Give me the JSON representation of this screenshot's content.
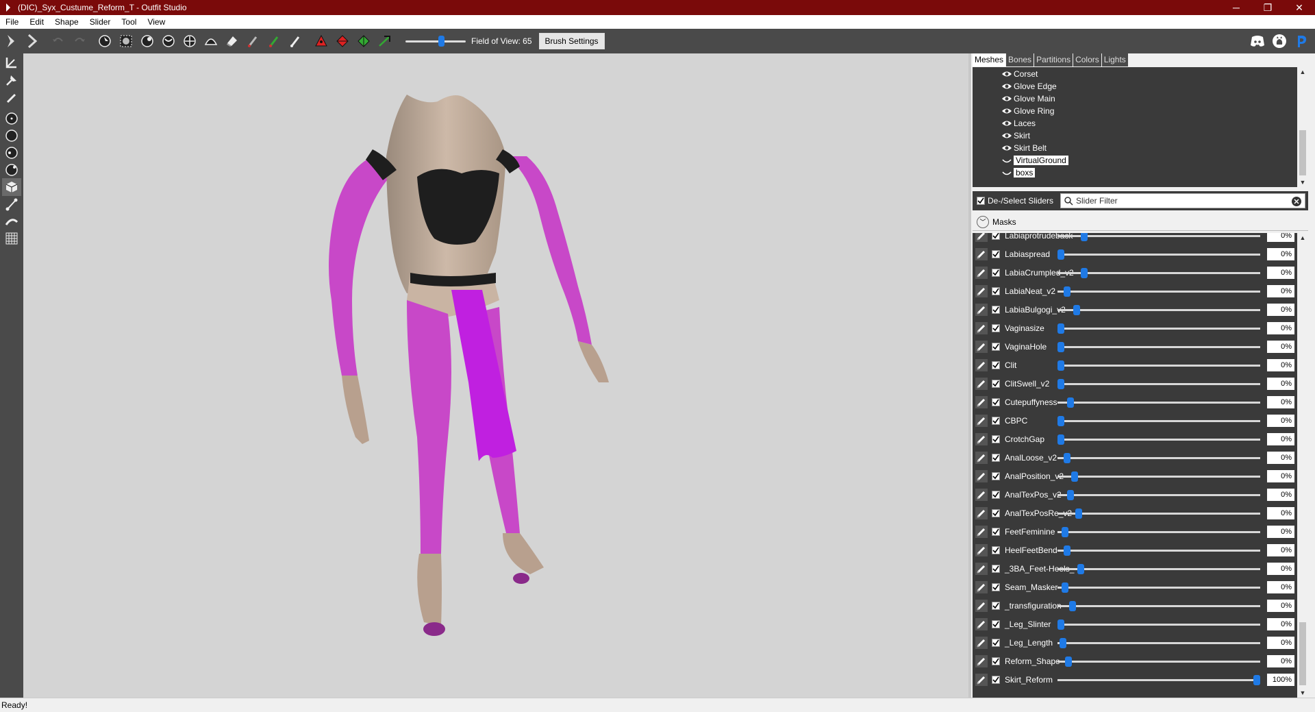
{
  "window": {
    "title": "(DIC)_Syx_Custume_Reform_T - Outfit Studio",
    "minimize": "─",
    "restore": "❐",
    "close": "✕"
  },
  "menu": [
    "File",
    "Edit",
    "Shape",
    "Slider",
    "Tool",
    "View"
  ],
  "toolbar": {
    "fov_label": "Field of View: 65",
    "fov_value": 65,
    "brush_settings_label": "Brush Settings"
  },
  "tabs": [
    {
      "label": "Meshes",
      "active": true
    },
    {
      "label": "Bones",
      "active": false
    },
    {
      "label": "Partitions",
      "active": false
    },
    {
      "label": "Colors",
      "active": false
    },
    {
      "label": "Lights",
      "active": false
    }
  ],
  "meshes": [
    {
      "name": "Corset",
      "visible": true
    },
    {
      "name": "Glove Edge",
      "visible": true
    },
    {
      "name": "Glove Main",
      "visible": true
    },
    {
      "name": "Glove Ring",
      "visible": true
    },
    {
      "name": "Laces",
      "visible": true
    },
    {
      "name": "Skirt",
      "visible": true
    },
    {
      "name": "Skirt Belt",
      "visible": true
    },
    {
      "name": "VirtualGround",
      "visible": false
    },
    {
      "name": "boxs",
      "visible": false
    }
  ],
  "sliders_header": {
    "deselect_label": "De-/Select Sliders",
    "filter_placeholder": "Slider Filter",
    "masks_label": "Masks"
  },
  "sliders": [
    {
      "name": "Labiaprotrudeback",
      "value": "0%",
      "pos": 0.12
    },
    {
      "name": "Labiaspread",
      "value": "0%",
      "pos": 0.0
    },
    {
      "name": "LabiaCrumpled_v2",
      "value": "0%",
      "pos": 0.12
    },
    {
      "name": "LabiaNeat_v2",
      "value": "0%",
      "pos": 0.03
    },
    {
      "name": "LabiaBulgogi_v2",
      "value": "0%",
      "pos": 0.08
    },
    {
      "name": "Vaginasize",
      "value": "0%",
      "pos": 0.0
    },
    {
      "name": "VaginaHole",
      "value": "0%",
      "pos": 0.0
    },
    {
      "name": "Clit",
      "value": "0%",
      "pos": 0.0
    },
    {
      "name": "ClitSwell_v2",
      "value": "0%",
      "pos": 0.0
    },
    {
      "name": "Cutepuffyness",
      "value": "0%",
      "pos": 0.05
    },
    {
      "name": "CBPC",
      "value": "0%",
      "pos": 0.0
    },
    {
      "name": "CrotchGap",
      "value": "0%",
      "pos": 0.0
    },
    {
      "name": "AnalLoose_v2",
      "value": "0%",
      "pos": 0.03
    },
    {
      "name": "AnalPosition_v2",
      "value": "0%",
      "pos": 0.07
    },
    {
      "name": "AnalTexPos_v2",
      "value": "0%",
      "pos": 0.05
    },
    {
      "name": "AnalTexPosRe_v2",
      "value": "0%",
      "pos": 0.09
    },
    {
      "name": "FeetFeminine",
      "value": "0%",
      "pos": 0.02
    },
    {
      "name": "HeelFeetBend",
      "value": "0%",
      "pos": 0.03
    },
    {
      "name": "_3BA_Feet-Heels_",
      "value": "0%",
      "pos": 0.1
    },
    {
      "name": "Seam_Masker",
      "value": "0%",
      "pos": 0.02
    },
    {
      "name": "_transfiguration",
      "value": "0%",
      "pos": 0.06
    },
    {
      "name": "_Leg_Slinter",
      "value": "0%",
      "pos": 0.0
    },
    {
      "name": "_Leg_Length",
      "value": "0%",
      "pos": 0.01
    },
    {
      "name": "Reform_Shape",
      "value": "0%",
      "pos": 0.04
    },
    {
      "name": "Skirt_Reform",
      "value": "100%",
      "pos": 1.0
    }
  ],
  "status": "Ready!",
  "colors": {
    "titlebar": "#7a0a0a",
    "toolbar": "#4a4a4a",
    "panel_dark": "#3a3a3a",
    "slider_thumb": "#1f7ae6",
    "viewport_bg": "#d4d4d4",
    "outfit_purple": "#c040c8"
  }
}
